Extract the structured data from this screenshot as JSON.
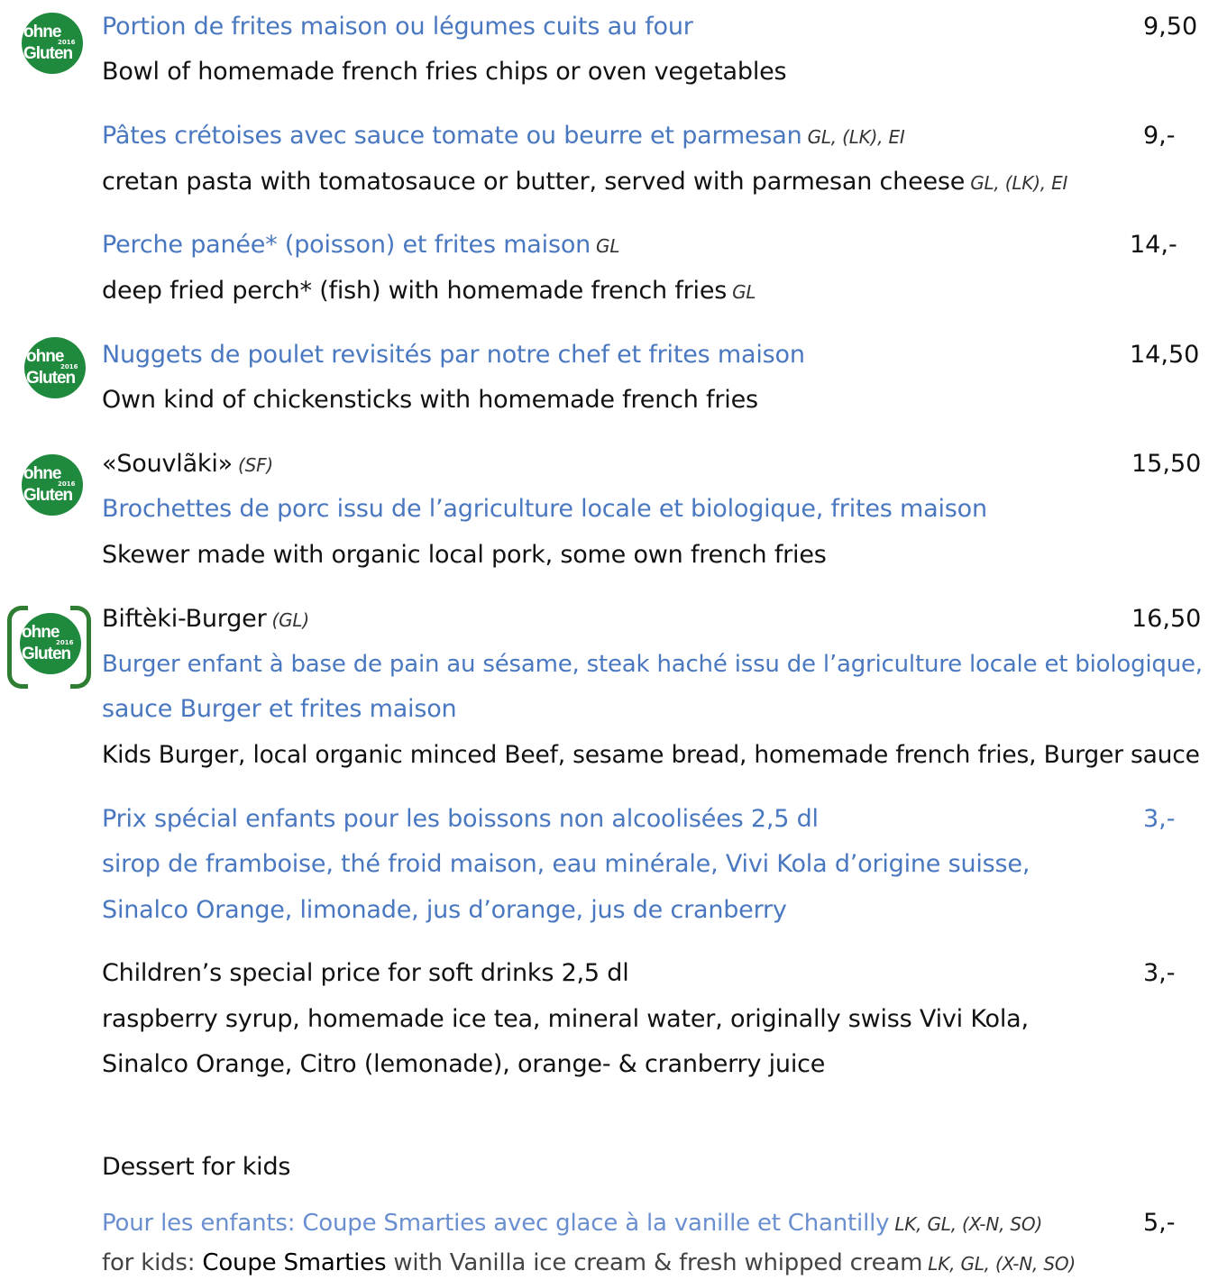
{
  "badge": {
    "line1": "ohne",
    "line2": "Gluten",
    "year": "2016"
  },
  "items": {
    "fries": {
      "fr": "Portion de frites maison ou légumes cuits au four",
      "en": "Bowl of homemade french fries chips or oven vegetables",
      "price": "9,50"
    },
    "pasta": {
      "fr": "Pâtes crétoises avec sauce tomate ou beurre et parmesan",
      "fr_tag": "GL, (LK), EI",
      "en": "cretan pasta with tomatosauce or butter, served with parmesan cheese",
      "en_tag": "GL, (LK), EI",
      "price": "9,-"
    },
    "perch": {
      "fr": "Perche panée* (poisson) et frites maison",
      "fr_tag": "GL",
      "en": "deep fried perch* (fish) with homemade french fries",
      "en_tag": "GL",
      "price": "14,-"
    },
    "nuggets": {
      "fr": "Nuggets de poulet revisités par notre chef et frites maison",
      "en": "Own kind of chickensticks with homemade french fries",
      "price": "14,50"
    },
    "souvlaki": {
      "title": "«Souvlãki»",
      "title_tag": "(SF)",
      "fr": "Brochettes de porc issu de l’agriculture locale et biologique, frites maison",
      "en": "Skewer made with organic local pork, some own french fries",
      "price": "15,50"
    },
    "burger": {
      "title": "Biftèki-Burger",
      "title_tag": "(GL)",
      "fr1": "Burger enfant à base de pain au sésame, steak haché issu de l’agriculture locale et biologique,",
      "fr2": "sauce Burger et frites maison",
      "en": "Kids Burger, local organic minced Beef, sesame bread, homemade french fries, Burger sauce",
      "price": "16,50"
    },
    "drinks_fr": {
      "l1": "Prix spécial enfants pour les boissons non alcoolisées 2,5 dl",
      "l2": "sirop de framboise, thé froid maison, eau minérale, Vivi Kola d’origine suisse,",
      "l3": "Sinalco Orange, limonade, jus d’orange, jus de cranberry",
      "price": "3,-"
    },
    "drinks_en": {
      "l1": "Children’s special price for soft drinks 2,5 dl",
      "l2": "raspberry syrup, homemade ice tea, mineral water, originally swiss Vivi Kola,",
      "l3": "Sinalco Orange, Citro (lemonade), orange- & cranberry juice",
      "price": "3,-"
    }
  },
  "dessert": {
    "heading": "Dessert for kids",
    "fr": "Pour les enfants: Coupe Smarties avec glace à la vanille et Chantilly",
    "fr_tag": "LK, GL, (X-N, SO)",
    "en_pre": "for kids: ",
    "en_bold": "Coupe Smarties",
    "en_post": " with Vanilla ice cream & fresh whipped cream",
    "en_tag": "LK, GL, (X-N, SO)",
    "price": "5,-"
  }
}
